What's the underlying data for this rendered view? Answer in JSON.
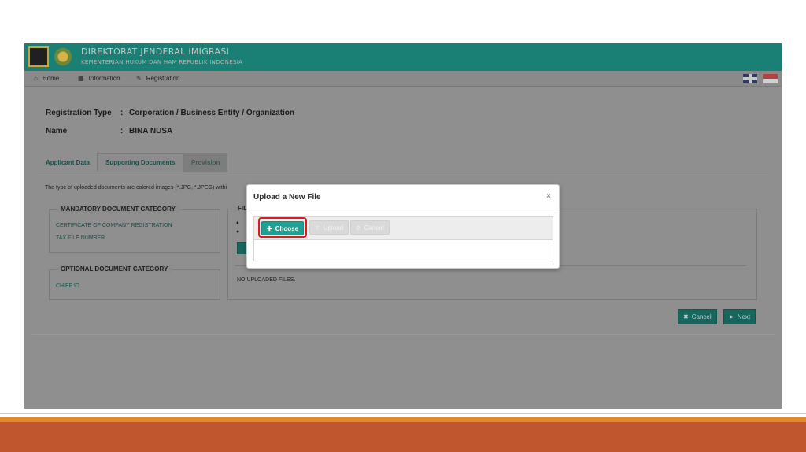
{
  "header": {
    "title": "DIREKTORAT JENDERAL IMIGRASI",
    "subtitle": "KEMENTERIAN HUKUM DAN HAM REPUBLIK INDONESIA"
  },
  "nav": {
    "items": [
      {
        "label": "Home",
        "icon": "home-icon"
      },
      {
        "label": "Information",
        "icon": "book-icon"
      },
      {
        "label": "Registration",
        "icon": "pen-icon"
      }
    ]
  },
  "form": {
    "registration_type_label": "Registration Type",
    "colon": ":",
    "registration_type_value": "Corporation / Business Entity / Organization",
    "name_label": "Name",
    "name_value": "BINA NUSA"
  },
  "tabs": [
    {
      "label": "Applicant Data"
    },
    {
      "label": "Supporting Documents"
    },
    {
      "label": "Provision"
    }
  ],
  "info_text": "The type of uploaded documents are colored images (*.JPG, *.JPEG) withi",
  "mandatory": {
    "legend": "MANDATORY DOCUMENT CATEGORY",
    "items": [
      "CERTIFICATE OF COMPANY REGISTRATION",
      "TAX FILE NUMBER"
    ]
  },
  "optional": {
    "legend": "OPTIONAL DOCUMENT CATEGORY",
    "items": [
      "CHIEF ID"
    ]
  },
  "files": {
    "legend": "FIL",
    "no_files": "NO UPLOADED FILES."
  },
  "actions": {
    "cancel": "Cancel",
    "next": "Next"
  },
  "modal": {
    "title": "Upload a New File",
    "close": "×",
    "choose": "Choose",
    "upload": "Upload",
    "cancel": "Cancel"
  }
}
